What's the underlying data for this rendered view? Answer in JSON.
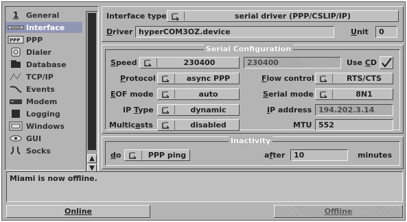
{
  "sidebar": {
    "items": [
      {
        "label": "General",
        "icon": "general-icon"
      },
      {
        "label": "Interface",
        "icon": "interface-icon"
      },
      {
        "label": "PPP",
        "icon": "ppp-icon"
      },
      {
        "label": "Dialer",
        "icon": "dialer-icon"
      },
      {
        "label": "Database",
        "icon": "database-icon"
      },
      {
        "label": "TCP/IP",
        "icon": "tcpip-icon"
      },
      {
        "label": "Events",
        "icon": "events-icon"
      },
      {
        "label": "Modem",
        "icon": "modem-icon"
      },
      {
        "label": "Logging",
        "icon": "logging-icon"
      },
      {
        "label": "Windows",
        "icon": "windows-icon"
      },
      {
        "label": "GUI",
        "icon": "gui-icon"
      },
      {
        "label": "Socks",
        "icon": "socks-icon"
      }
    ],
    "selected": "Interface",
    "general_number": "1"
  },
  "interface": {
    "type_label": "Interface type",
    "type_value": "serial driver (PPP/CSLIP/IP)",
    "driver_label": "Driver",
    "driver_value": "hyperCOM3OZ.device",
    "unit_label": "Unit",
    "unit_value": "0"
  },
  "serial": {
    "group_title": "Serial Configuration",
    "speed_label": "Speed",
    "speed_value": "230400",
    "speed_field": "230400",
    "use_cd_label": "Use CD",
    "use_cd_checked": true,
    "protocol_label": "Protocol",
    "protocol_value": "async PPP",
    "flow_label": "Flow control",
    "flow_value": "RTS/CTS",
    "eof_label": "EOF mode",
    "eof_value": "auto",
    "serial_mode_label": "Serial mode",
    "serial_mode_value": "8N1",
    "ip_type_label": "IP Type",
    "ip_type_value": "dynamic",
    "ip_addr_label": "IP address",
    "ip_addr_value": "194.202.3.14",
    "multicasts_label": "Multicasts",
    "multicasts_value": "disabled",
    "mtu_label": "MTU",
    "mtu_value": "552"
  },
  "inactivity": {
    "group_title": "Inactivity",
    "do_label": "do",
    "do_value": "PPP ping",
    "after_label": "after",
    "after_value": "10",
    "minutes_label": "minutes"
  },
  "log": {
    "message": "Miami is now offline."
  },
  "buttons": {
    "online": "Online",
    "offline": "Offline"
  }
}
